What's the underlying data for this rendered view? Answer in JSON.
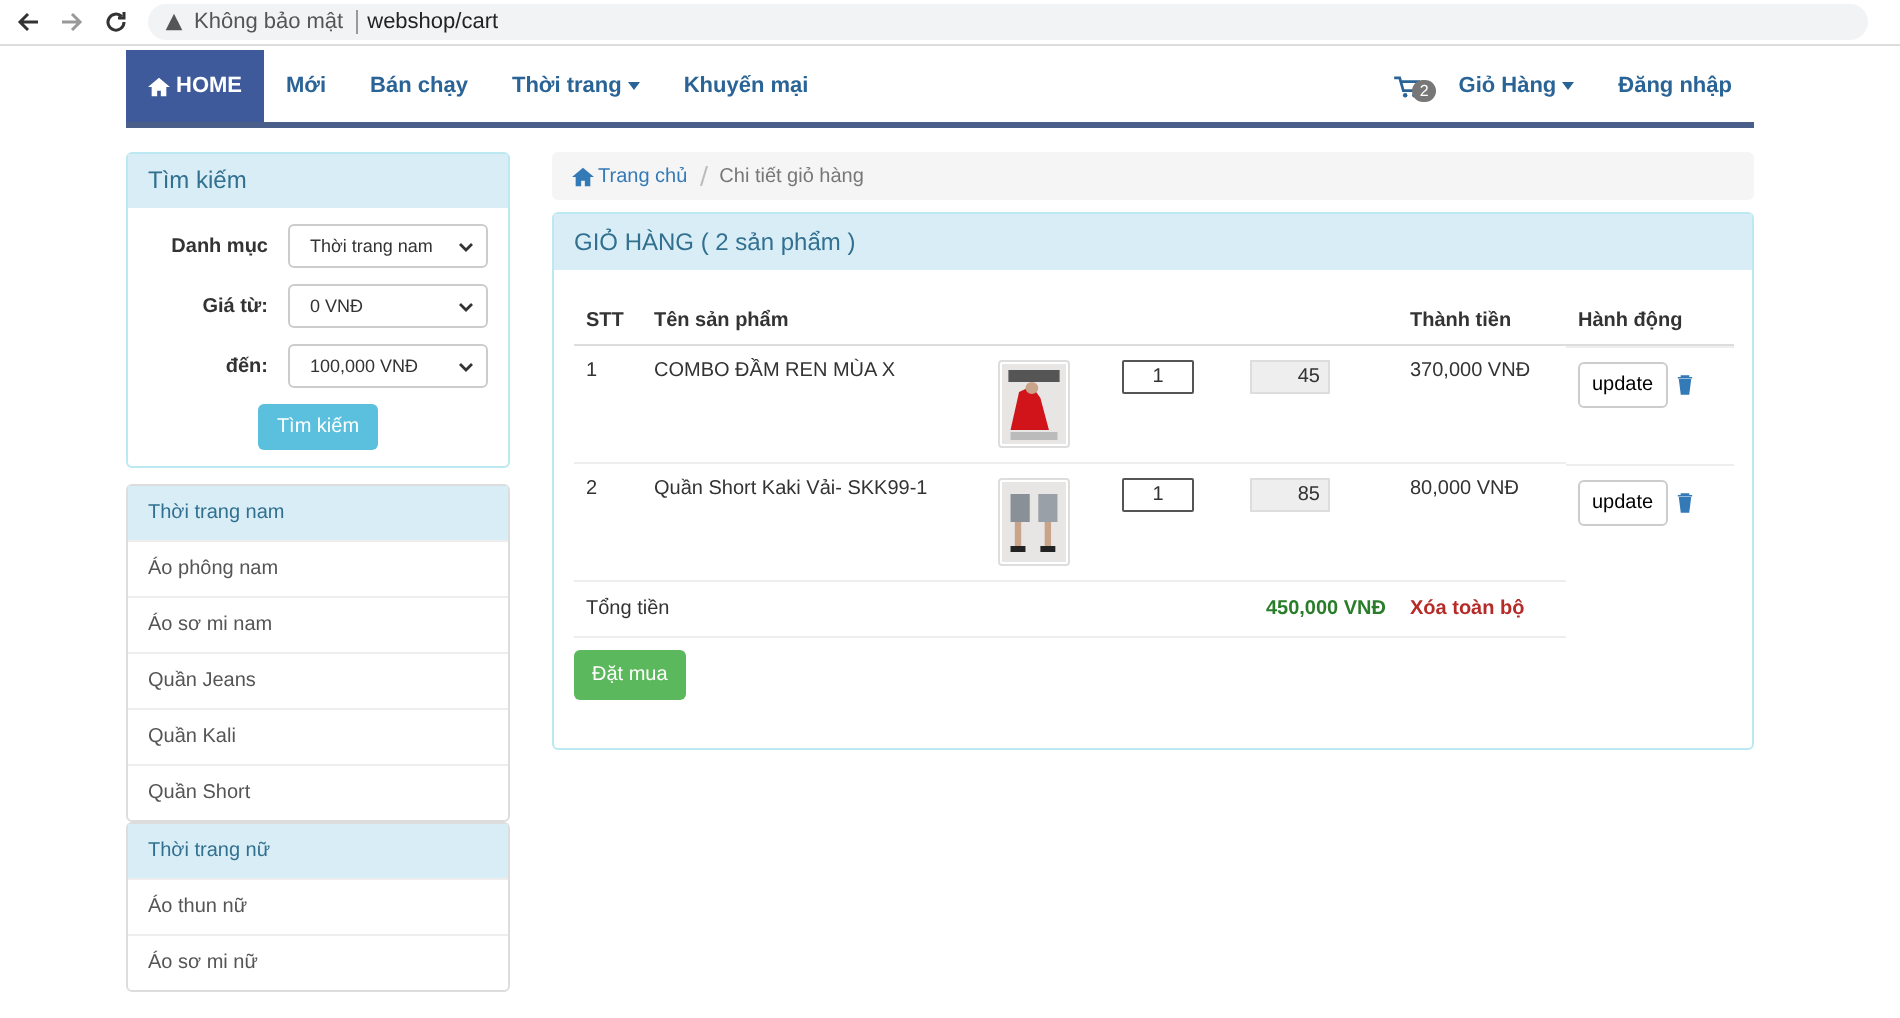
{
  "browser": {
    "security": "Không bảo mật",
    "url": "webshop/cart"
  },
  "nav": {
    "items": [
      {
        "label": "HOME",
        "selected": true,
        "dropdown": false
      },
      {
        "label": "Mới",
        "selected": false,
        "dropdown": false
      },
      {
        "label": "Bán chạy",
        "selected": false,
        "dropdown": false
      },
      {
        "label": "Thời trang",
        "selected": false,
        "dropdown": true
      },
      {
        "label": "Khuyến mại",
        "selected": false,
        "dropdown": false
      }
    ],
    "cart_count": "2",
    "cart_label": "Giỏ Hàng",
    "login": "Đăng nhập"
  },
  "search": {
    "title": "Tìm kiếm",
    "fields": [
      {
        "label": "Danh mục",
        "value": "Thời trang nam"
      },
      {
        "label": "Giá từ:",
        "value": "0 VNĐ"
      },
      {
        "label": "đến:",
        "value": "100,000 VNĐ"
      }
    ],
    "button": "Tìm kiếm"
  },
  "categories": [
    {
      "title": "Thời trang nam",
      "items": [
        "Áo phông nam",
        "Áo sơ mi nam",
        "Quần Jeans",
        "Quần Kali",
        "Quần Short"
      ]
    },
    {
      "title": "Thời trang nữ",
      "items": [
        "Áo thun nữ",
        "Áo sơ mi nữ"
      ]
    }
  ],
  "breadcrumb": [
    "Trang chủ",
    "Chi tiết giỏ hàng"
  ],
  "cart": {
    "title": "GIỎ HÀNG ( 2 sản phẩm )",
    "columns": [
      "STT",
      "Tên sản phẩm",
      "Thành tiền",
      "Hành động"
    ],
    "rows": [
      {
        "index": "1",
        "name": "COMBO ĐẦM REN MÙA X",
        "quantity": "1",
        "price": "45",
        "total": "370,000 VNĐ",
        "action": "update"
      },
      {
        "index": "2",
        "name": "Quần Short Kaki Vải- SKK99-1",
        "quantity": "1",
        "price": "85",
        "total": "80,000 VNĐ",
        "action": "update"
      }
    ],
    "total_label": "Tổng tiền",
    "total": "450,000 VNĐ",
    "clear": "Xóa toàn bộ",
    "order": "Đặt mua"
  }
}
